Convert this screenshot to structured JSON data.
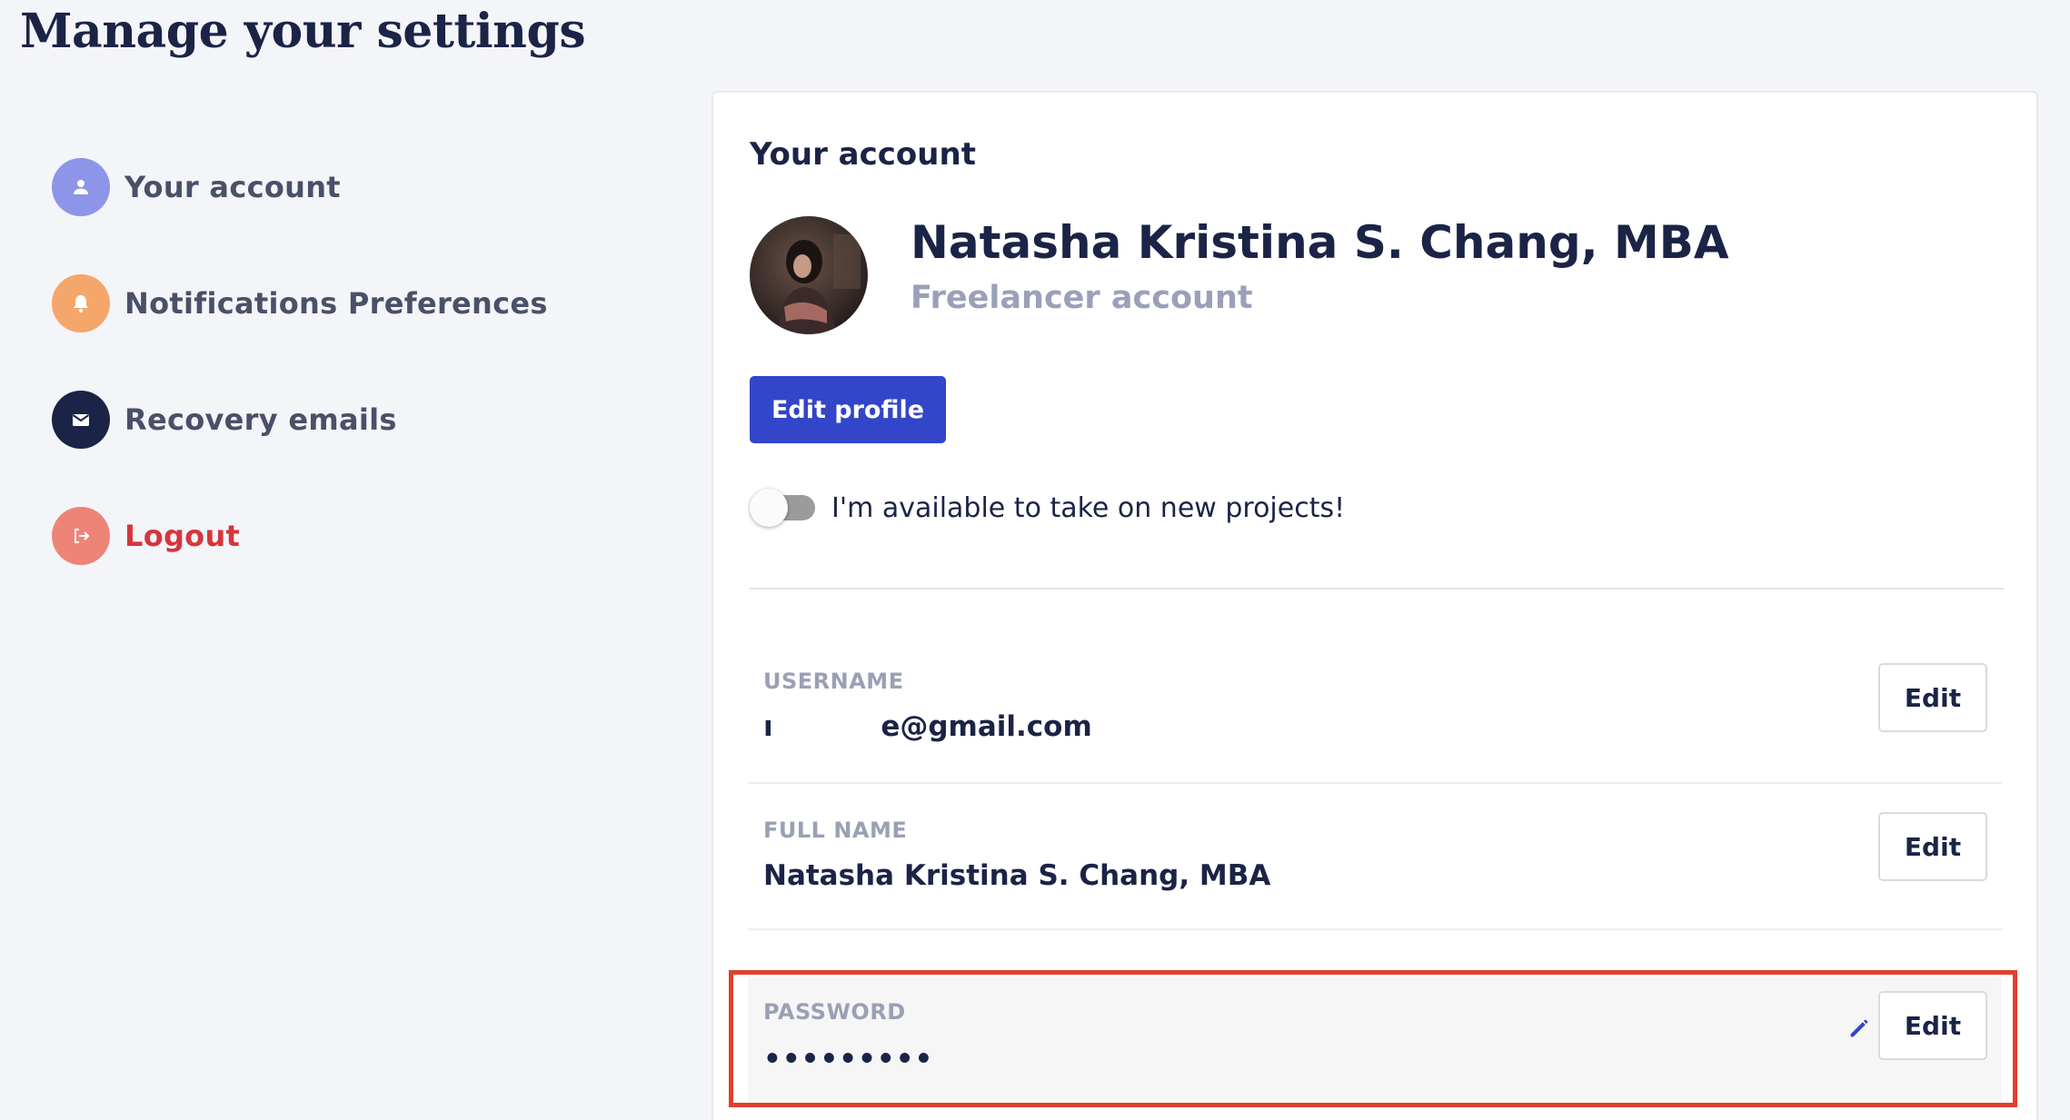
{
  "page": {
    "title": "Manage your settings"
  },
  "sidebar": {
    "items": [
      {
        "label": "Your account",
        "icon": "user-icon"
      },
      {
        "label": "Notifications Preferences",
        "icon": "bell-icon"
      },
      {
        "label": "Recovery emails",
        "icon": "mail-icon"
      },
      {
        "label": "Logout",
        "icon": "logout-icon"
      }
    ]
  },
  "account": {
    "heading": "Your account",
    "name": "Natasha Kristina S. Chang, MBA",
    "account_type": "Freelancer account",
    "edit_profile_label": "Edit profile",
    "availability_label": "I'm available to take on new projects!",
    "availability_on": false
  },
  "fields": {
    "username": {
      "label": "USERNAME",
      "value": "ı           e@gmail.com",
      "edit_label": "Edit"
    },
    "full_name": {
      "label": "FULL NAME",
      "value": "Natasha Kristina S. Chang, MBA",
      "edit_label": "Edit"
    },
    "password": {
      "label": "PASSWORD",
      "value": "•••••••••",
      "edit_label": "Edit"
    }
  },
  "colors": {
    "primary": "#3345c8",
    "highlight": "#e0412e",
    "logout": "#d4373c",
    "navy": "#1b2446"
  }
}
